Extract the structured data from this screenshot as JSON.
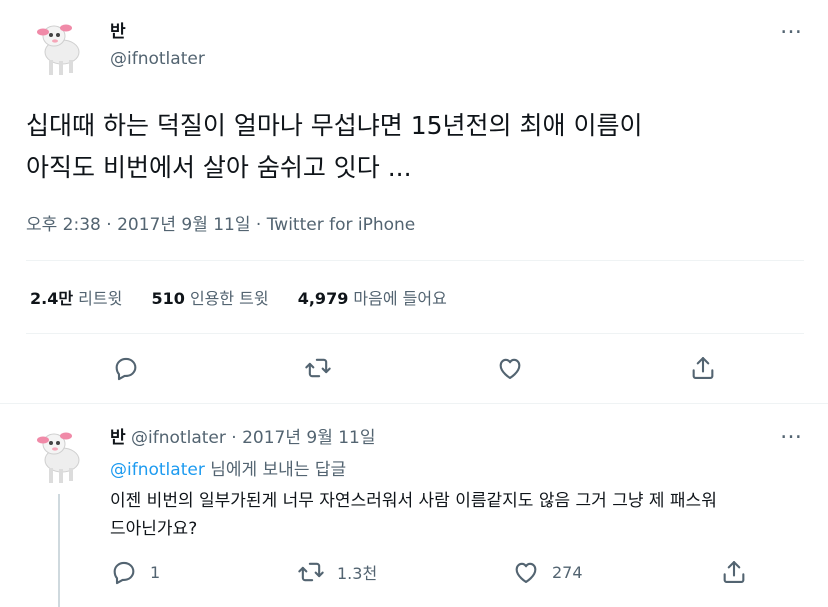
{
  "main_tweet": {
    "display_name": "반",
    "handle": "@ifnotlater",
    "text_line1": "십대때 하는 덕질이 얼마나 무섭냐면 15년전의 최애 이름이",
    "text_line2": "아직도 비번에서 살아 숨쉬고 잇다 ...",
    "meta": "오후 2:38 · 2017년 9월 11일 · Twitter for iPhone",
    "stats": {
      "retweets_num": "2.4만",
      "retweets_label": "리트윗",
      "quotes_num": "510",
      "quotes_label": "인용한 트윗",
      "likes_num": "4,979",
      "likes_label": "마음에 들어요"
    },
    "more_icon": "…"
  },
  "reply": {
    "display_name": "반",
    "handle": "@ifnotlater",
    "separator": "·",
    "date": "2017년 9월 11일",
    "replying_to_handle": "@ifnotlater",
    "replying_to_suffix": "님에게 보내는 답글",
    "text_line1": "이젠 비번의 일부가된게 너무 자연스러워서 사람 이름같지도 않음 그거 그냥 제 패스워",
    "text_line2": "드아닌가요?",
    "counts": {
      "replies": "1",
      "retweets": "1.3천",
      "likes": "274"
    },
    "more_icon": "…"
  },
  "icons": {
    "reply": "reply-icon",
    "retweet": "retweet-icon",
    "like": "heart-icon",
    "share": "share-icon"
  },
  "colors": {
    "link": "#1d9bf0",
    "muted": "#536471",
    "divider": "#eff3f4",
    "text": "#0f1419"
  }
}
